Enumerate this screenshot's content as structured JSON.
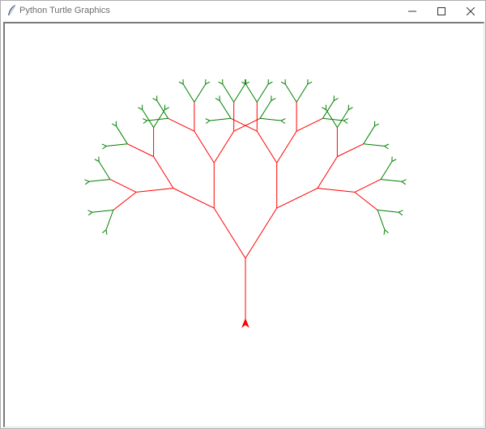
{
  "window": {
    "title": "Python Turtle Graphics"
  },
  "icons": {
    "app": "feather-icon",
    "minimize": "minimize-icon",
    "maximize": "maximize-icon",
    "close": "close-icon",
    "turtle": "turtle-arrow-icon"
  },
  "colors": {
    "trunk_branches": "#ff0000",
    "leaves": "#008000",
    "canvas_background": "#ffffff"
  },
  "drawing": {
    "shape": "fractal-tree",
    "levels": 6
  }
}
